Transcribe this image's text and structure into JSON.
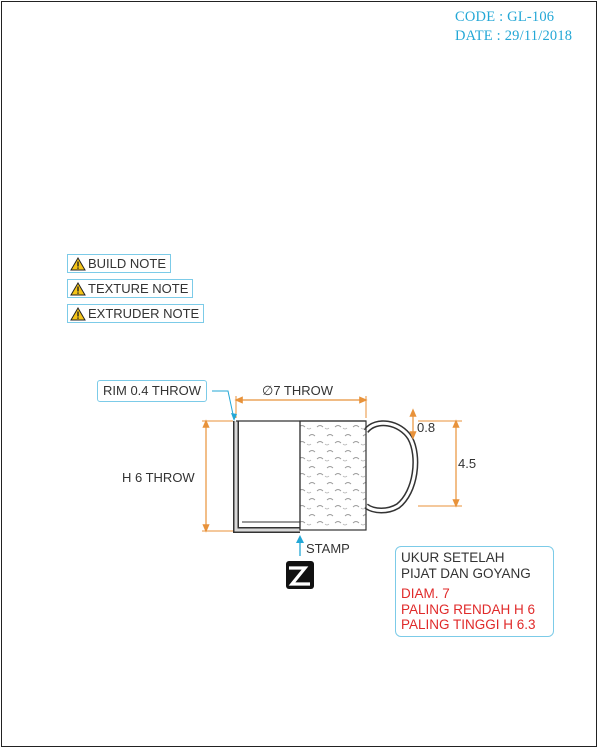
{
  "header": {
    "code": "CODE : GL-106",
    "date": "DATE : 29/11/2018"
  },
  "notes": [
    {
      "label": "BUILD NOTE",
      "icon": "warning-icon"
    },
    {
      "label": "TEXTURE NOTE",
      "icon": "warning-icon"
    },
    {
      "label": "EXTRUDER NOTE",
      "icon": "warning-icon"
    }
  ],
  "dimensions": {
    "rim": "RIM 0.4 THROW",
    "diameter": "∅7 THROW",
    "height": "H 6 THROW",
    "loop_thickness": "0.8",
    "loop_height": "4.5",
    "stamp": "STAMP"
  },
  "info": {
    "lines_black": [
      "UKUR SETELAH",
      "PIJAT DAN GOYANG"
    ],
    "lines_red": [
      "DIAM. 7",
      "PALING RENDAH H 6",
      "PALING TINGGI H 6.3"
    ]
  },
  "colors": {
    "accent": "#23a7d6",
    "dimension": "#e8923a",
    "warning_text": "#e02a2a"
  }
}
